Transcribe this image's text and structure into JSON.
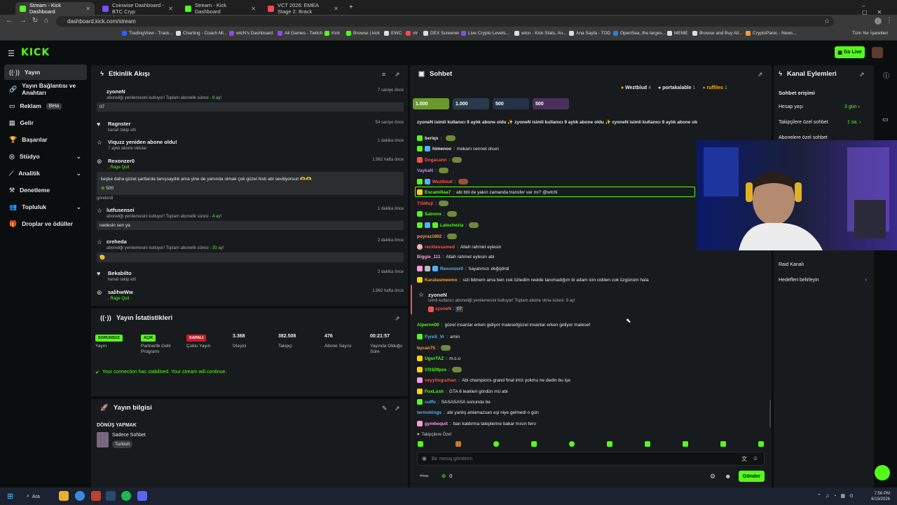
{
  "browser": {
    "tabs": [
      {
        "title": "Stream - Kick Dashboard",
        "active": true
      },
      {
        "title": "Coinwise Dashboard - BTC Cryp",
        "active": false
      },
      {
        "title": "Stream - Kick Dashboard",
        "active": false
      },
      {
        "title": "VCT 2026: EMEA Stage 2: Brack",
        "active": false
      }
    ],
    "url": "dashboard.kick.com/stream",
    "bookmarks": [
      "TradingView - Track...",
      "Charting - Coach Mi...",
      "wtcN's Dashboard",
      "All Games - Twitch",
      "Kick",
      "Browse | kick",
      "EWC",
      "vlr",
      "DEX Screener",
      "Live Crypto Levels...",
      "wtcn - Kick Stats, An...",
      "Ana Sayfa - TOD",
      "OpenSea, the larges...",
      "MEME",
      "Browse and Buy All...",
      "CryptoPanic - News..."
    ],
    "all_bookmarks": "Tüm Yer İşaretleri"
  },
  "header": {
    "logo": "KICK",
    "go_live": "Go Live"
  },
  "sidebar": {
    "items": [
      {
        "label": "Yayın",
        "active": true
      },
      {
        "label": "Yayın Bağlantısı ve Anahtarı"
      },
      {
        "label": "Reklam",
        "badge": "Beta"
      },
      {
        "label": "Gelir"
      },
      {
        "label": "Başarılar"
      },
      {
        "label": "Stüdyo",
        "chevron": true
      },
      {
        "label": "Analitik",
        "chevron": true
      },
      {
        "label": "Denetleme"
      },
      {
        "label": "Topluluk",
        "chevron": true
      },
      {
        "label": "Droplar ve ödüller"
      }
    ]
  },
  "activity": {
    "title": "Etkinlik Akışı",
    "events": [
      {
        "name": "zyoneN",
        "time": "7 saniye önce",
        "sub": "aboneliği yenilemesini kutluyor! Toplam abonelik süresi - ",
        "sub_g": "9",
        "sub_end": " ay!",
        "box": "07"
      },
      {
        "name": "Ragnster",
        "time": "54 saniye önce",
        "sub": "kanalı takip etti"
      },
      {
        "name": "Viquzz yeniden abone oldu!",
        "time": "1 dakika önce",
        "sub": "7 aylık abone oldular"
      },
      {
        "name": "Rexonzer0",
        "time": "1.962 hafta önce",
        "sub_g_only": ", Rage Quit",
        "box": "keşke daha güzel şartlarda tanışsaydık ama yine de yanında olmak çok güzel histi abi seviliyorsun 🫶🫶",
        "amount": "500",
        "after": "gönderdi"
      },
      {
        "name": "lutfusensei",
        "time": "1 dakika önce",
        "sub": "aboneliği yenilemesini kutluyor! Toplam abonelik süresi - ",
        "sub_g": "4",
        "sub_end": " ay!",
        "box": "nedesin sen ya"
      },
      {
        "name": "creheda",
        "time": "2 dakika önce",
        "sub": "aboneliği yenilemesini kutluyor! Toplam abonelik süresi - ",
        "sub_g": "20",
        "sub_end": " ay!",
        "box": "🫡"
      },
      {
        "name": "Bekabilto",
        "time": "2 dakika önce",
        "sub": "kanalı takip etti"
      },
      {
        "name": "salihwWw",
        "time": "1.962 hafta önce",
        "sub_g_only": ", Rage Quit"
      }
    ]
  },
  "stats": {
    "title": "Yayın İstatistikleri",
    "cols": [
      {
        "badge": "SORUNSUZ",
        "label": "Yayın"
      },
      {
        "badge": "AÇIK",
        "label": "Partnerlik Gelir Programı"
      },
      {
        "badge": "KAPALI",
        "label": "Çoklu Yayın"
      },
      {
        "value": "3.368",
        "label": "İzleyici"
      },
      {
        "value": "382.508",
        "label": "Takipçi"
      },
      {
        "value": "476",
        "label": "Abone Sayısı"
      },
      {
        "value": "00:21:57",
        "label": "Yayında Olduğu Süre"
      }
    ],
    "notice": "Your connection has stabilised. Your stream will continue."
  },
  "stream_info": {
    "title": "Yayın bilgisi",
    "stream_title": "DÖNÜŞ YAPMAK",
    "category": "Sadece Sohbet",
    "tag": "Turkish"
  },
  "chat": {
    "title": "Sohbet",
    "top_subs": [
      {
        "name": "Weztblud",
        "count": "4"
      },
      {
        "name": "portakalable",
        "count": "1"
      },
      {
        "name": "ruffiles",
        "count": "1"
      }
    ],
    "chips": [
      "1.000",
      "1.000",
      "500",
      "500"
    ],
    "ticker": "zyoneN isimli kullanıcı 9 aylık abone oldu ✨ zyoneN isimli kullanıcı 9 aylık abone oldu ✨ zyoneN isimli kullanıcı 9 aylık abone oldu ✨ zyoneN",
    "messages": [
      {
        "user": "beriqx",
        "text": "",
        "color": "#e8e8e8"
      },
      {
        "user": "himenoo",
        "text": "mekanı cennet olsun",
        "color": "#e8e8e8"
      },
      {
        "user": "Dogacann",
        "text": "",
        "color": "#ff4f4f"
      },
      {
        "user": "VaykaN",
        "text": "",
        "color": "#c38bff"
      },
      {
        "user": "Weztblud",
        "text": "",
        "color": "#ff4f4f"
      },
      {
        "user": "Escamillaa7",
        "text": "abi bbl de yakın zamanda transfer var mı? @wtcN",
        "color": "#53fc18",
        "highlight": true
      },
      {
        "user": "TSIMuji",
        "text": "",
        "color": "#ff4f4f"
      },
      {
        "user": "Saironx",
        "text": "",
        "color": "#53fc18"
      },
      {
        "user": "Lalochezia",
        "text": "",
        "color": "#53fc18"
      },
      {
        "user": "poyraz1892",
        "text": "",
        "color": "#ff9a3c"
      },
      {
        "user": "recklessamed",
        "text": "Allah rahmet eylesin",
        "color": "#ff4f4f"
      },
      {
        "user": "Biggie_111",
        "text": "Allah rahmet eylesin abi",
        "color": "#ff9ae0"
      },
      {
        "user": "Rexonzer0",
        "text": "hayatımızı değiştirdi",
        "color": "#4fb3ff"
      },
      {
        "user": "Karatasmeemo",
        "text": "sizi bilmem ama ben cok özledim reelde tanımadığım bi adam icin cidden cok üzgünüm hala",
        "color": "#ff9a3c"
      }
    ],
    "sub_event": {
      "user": "zyoneN",
      "text": "isimli kullanıcı aboneliği yenilemesini kutluyor! Toplam abone olma süresi: 9 ay!",
      "reply_user": "zyoneN",
      "reply_text": "07"
    },
    "messages2": [
      {
        "user": "Alpernn00",
        "text": "güzel insanlar erken gidiyor malesefgüzel insanlar erken gidiyor malesef",
        "color": "#53fc18"
      },
      {
        "user": "FyreX_Vr",
        "text": "amin",
        "color": "#4fb3ff"
      },
      {
        "user": "bycan75",
        "text": "",
        "color": "#ff9a3c"
      },
      {
        "user": "UgurTAZ",
        "text": "m.c.o",
        "color": "#53fc18"
      },
      {
        "user": "VO1Dfpss",
        "text": "",
        "color": "#53fc18"
      },
      {
        "user": "veyyitoguzhan",
        "text": "Abi champions grand final imiz yokmu ne dedin bu işe",
        "color": "#ff4f4f"
      },
      {
        "user": "FoxLush",
        "text": "GTA 6 leakleri gördün mü abi",
        "color": "#53fc18"
      },
      {
        "user": "cuffo",
        "text": "SASASASA sonunda be",
        "color": "#4fb3ff"
      },
      {
        "user": "termokings",
        "text": "abi yanlış anlamazsan eşi niye gelmedi o gün",
        "color": "#4fb3ff"
      },
      {
        "user": "gymbequit",
        "text": "ban kaldırma taleplerine bakar mısın fero",
        "color": "#ff9ae0"
      }
    ],
    "followers_only": "Takipçilere Özel",
    "input_placeholder": "Bir mesaj gönderin",
    "send": "Gönder",
    "points": "0"
  },
  "channel_actions": {
    "title": "Kanal Eylemleri",
    "section": "Sohbet erişimi",
    "rows": [
      {
        "label": "Hesap yaşı",
        "value": "3 gün"
      },
      {
        "label": "Takipçilere özel sohbet",
        "value": "1 sa."
      },
      {
        "label": "Abonelere özel sohbet",
        "value": ""
      }
    ],
    "raid": "Raid Kanalı",
    "goals": "Hedefleri belirleyin"
  },
  "taskbar": {
    "search": "Ara",
    "time": "7:56 PM",
    "date": "6/19/2026"
  }
}
